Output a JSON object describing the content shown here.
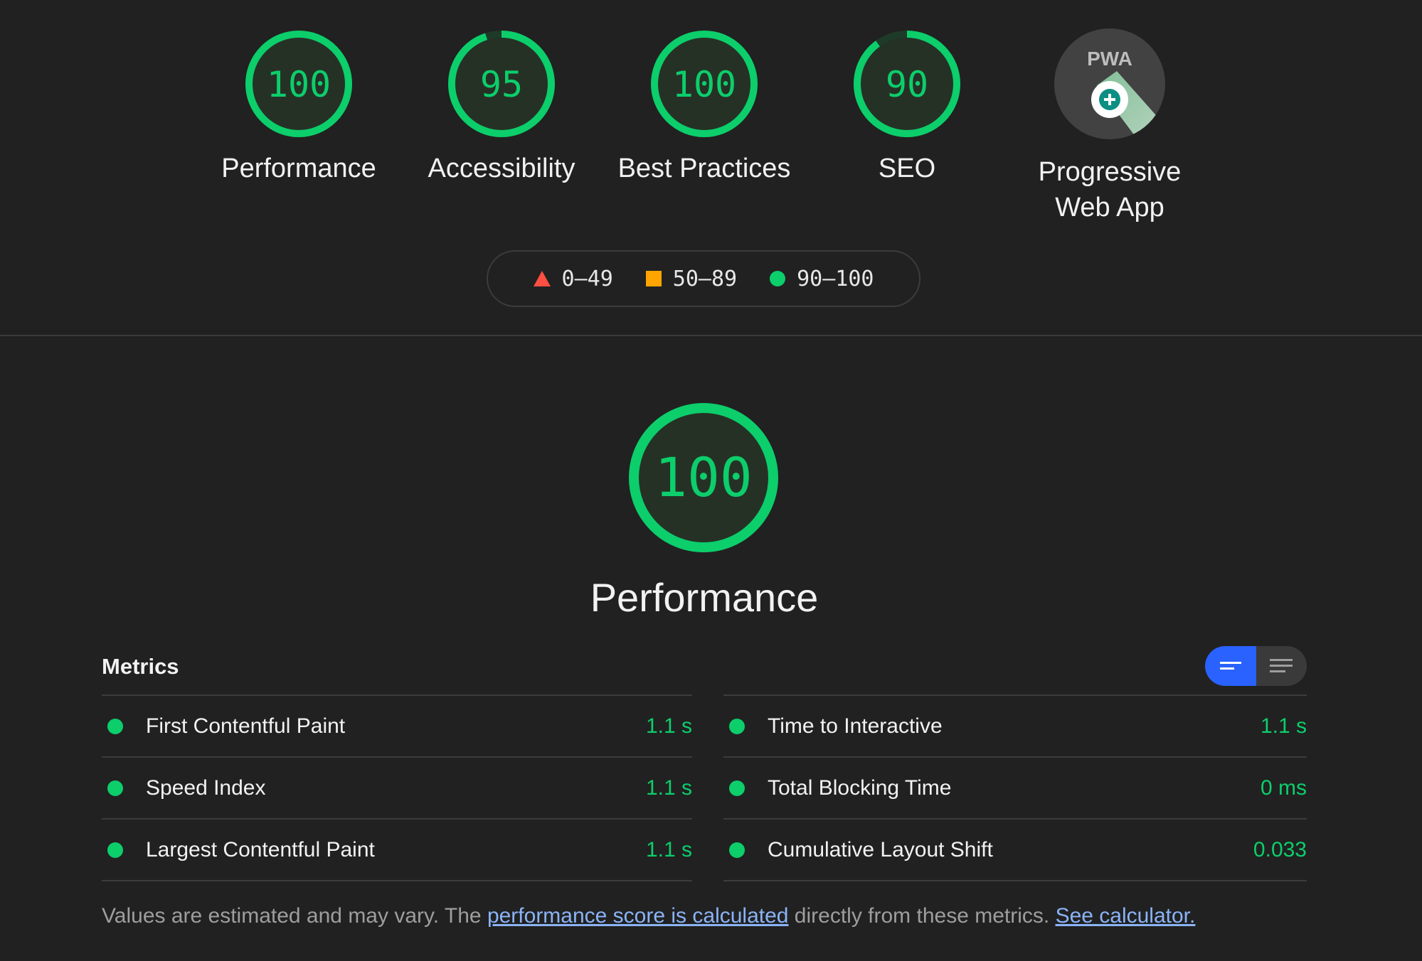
{
  "gauges": [
    {
      "label": "Performance",
      "score": "100",
      "value": 100
    },
    {
      "label": "Accessibility",
      "score": "95",
      "value": 95
    },
    {
      "label": "Best Practices",
      "score": "100",
      "value": 100
    },
    {
      "label": "SEO",
      "score": "90",
      "value": 90
    }
  ],
  "pwa": {
    "label_line1": "Progressive",
    "label_line2": "Web App",
    "badge_text": "PWA"
  },
  "legend": {
    "fail": "0–49",
    "average": "50–89",
    "pass": "90–100"
  },
  "performance": {
    "score": "100",
    "value": 100,
    "title": "Performance"
  },
  "metrics": {
    "title": "Metrics",
    "left": [
      {
        "name": "First Contentful Paint",
        "value": "1.1 s"
      },
      {
        "name": "Speed Index",
        "value": "1.1 s"
      },
      {
        "name": "Largest Contentful Paint",
        "value": "1.1 s"
      }
    ],
    "right": [
      {
        "name": "Time to Interactive",
        "value": "1.1 s"
      },
      {
        "name": "Total Blocking Time",
        "value": "0 ms"
      },
      {
        "name": "Cumulative Layout Shift",
        "value": "0.033"
      }
    ]
  },
  "footnote": {
    "part1": "Values are estimated and may vary. The ",
    "link1": "performance score is calculated",
    "part2": " directly from these metrics. ",
    "link2": "See calculator."
  },
  "colors": {
    "pass": "#0cce6b",
    "average": "#ffa400",
    "fail": "#ff4e42",
    "toggle_active": "#2962ff"
  }
}
